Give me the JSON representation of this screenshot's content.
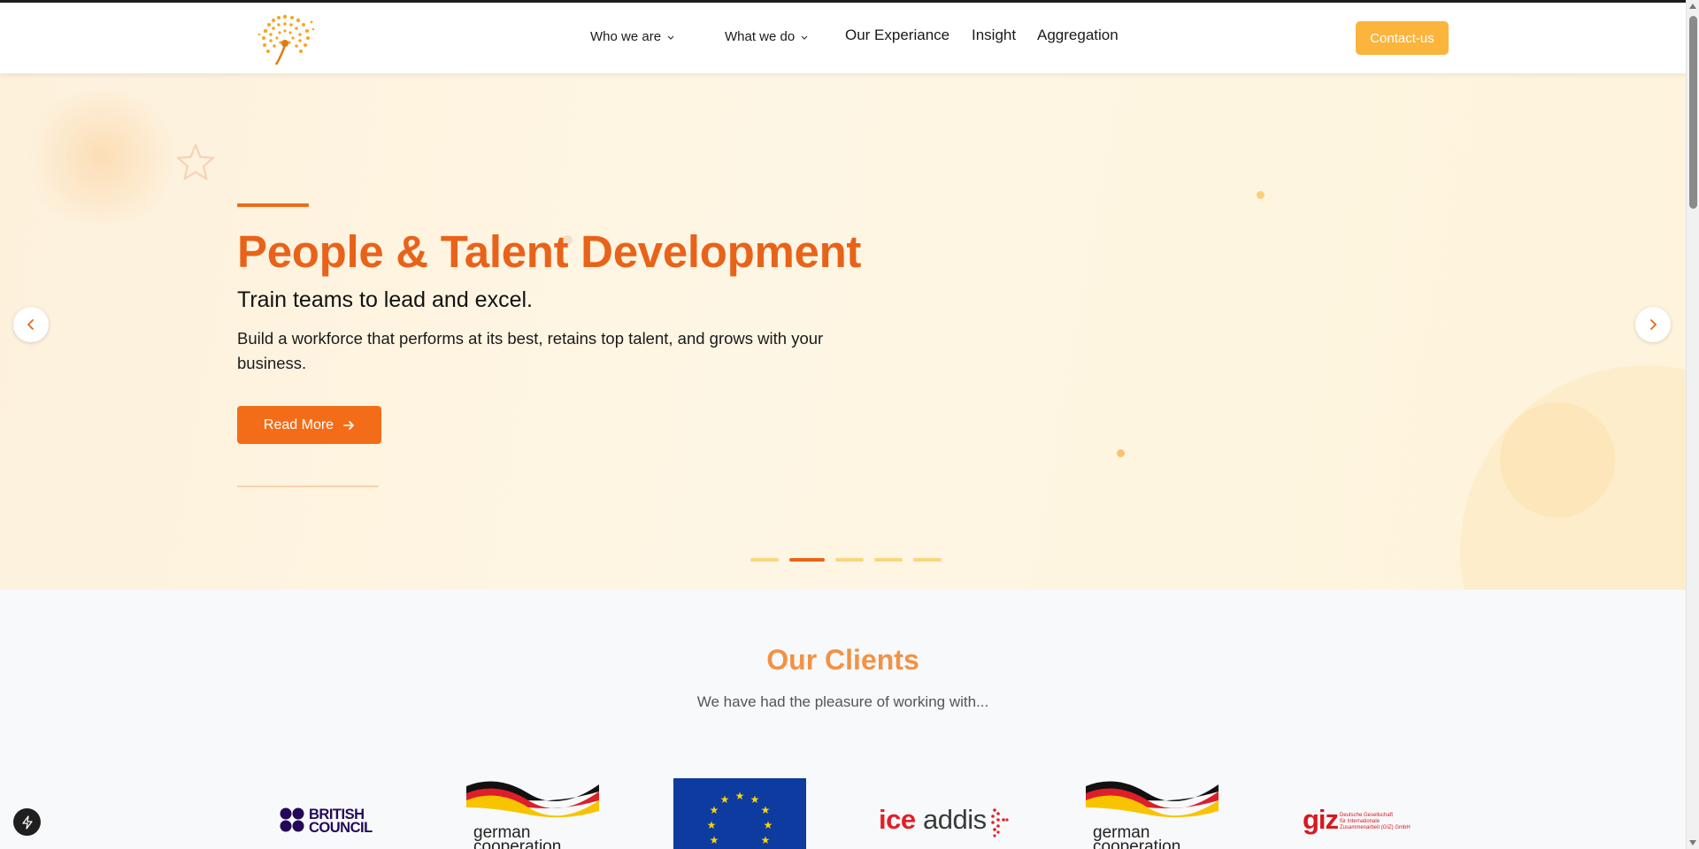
{
  "nav": {
    "items": [
      {
        "label": "Who we are",
        "dropdown": true
      },
      {
        "label": "What we do",
        "dropdown": true
      },
      {
        "label": "Our Experiance",
        "dropdown": false
      },
      {
        "label": "Insight",
        "dropdown": false
      },
      {
        "label": "Aggregation",
        "dropdown": false
      }
    ],
    "contact_label": "Contact-us"
  },
  "hero": {
    "title": "People & Talent Development",
    "subtitle": "Train teams to lead and excel.",
    "description": "Build a workforce that performs at its best, retains top talent, and grows with your business.",
    "read_more_label": "Read More",
    "slide_count": 5,
    "active_slide": 2
  },
  "clients": {
    "title": "Our Clients",
    "subtitle": "We have had the pleasure of working with...",
    "logos": [
      {
        "name": "British Council",
        "line1": "BRITISH",
        "line2": "COUNCIL"
      },
      {
        "name": "German Cooperation",
        "line1": "german",
        "line2": "cooperation"
      },
      {
        "name": "European Union"
      },
      {
        "name": "iceaddis",
        "part1": "ice",
        "part2": "addis"
      },
      {
        "name": "German Cooperation",
        "line1": "german",
        "line2": "cooperation"
      },
      {
        "name": "giz",
        "mark": "giz",
        "text1": "Deutsche Gesellschaft",
        "text2": "für Internationale",
        "text3": "Zusammenarbeit (GIZ) GmbH"
      }
    ]
  },
  "colors": {
    "brand_orange": "#e8631a",
    "button_orange": "#f36d18",
    "contact_yellow": "#fbb43c",
    "indicator_inactive": "#fbd67e"
  }
}
